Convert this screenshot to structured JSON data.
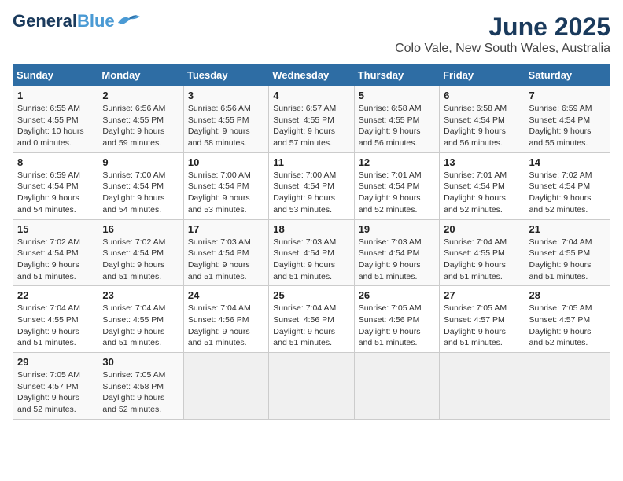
{
  "logo": {
    "text_general": "General",
    "text_blue": "Blue"
  },
  "title": "June 2025",
  "subtitle": "Colo Vale, New South Wales, Australia",
  "days_of_week": [
    "Sunday",
    "Monday",
    "Tuesday",
    "Wednesday",
    "Thursday",
    "Friday",
    "Saturday"
  ],
  "weeks": [
    [
      {
        "day": "1",
        "sunrise": "6:55 AM",
        "sunset": "4:55 PM",
        "daylight": "10 hours and 0 minutes."
      },
      {
        "day": "2",
        "sunrise": "6:56 AM",
        "sunset": "4:55 PM",
        "daylight": "9 hours and 59 minutes."
      },
      {
        "day": "3",
        "sunrise": "6:56 AM",
        "sunset": "4:55 PM",
        "daylight": "9 hours and 58 minutes."
      },
      {
        "day": "4",
        "sunrise": "6:57 AM",
        "sunset": "4:55 PM",
        "daylight": "9 hours and 57 minutes."
      },
      {
        "day": "5",
        "sunrise": "6:58 AM",
        "sunset": "4:55 PM",
        "daylight": "9 hours and 56 minutes."
      },
      {
        "day": "6",
        "sunrise": "6:58 AM",
        "sunset": "4:54 PM",
        "daylight": "9 hours and 56 minutes."
      },
      {
        "day": "7",
        "sunrise": "6:59 AM",
        "sunset": "4:54 PM",
        "daylight": "9 hours and 55 minutes."
      }
    ],
    [
      {
        "day": "8",
        "sunrise": "6:59 AM",
        "sunset": "4:54 PM",
        "daylight": "9 hours and 54 minutes."
      },
      {
        "day": "9",
        "sunrise": "7:00 AM",
        "sunset": "4:54 PM",
        "daylight": "9 hours and 54 minutes."
      },
      {
        "day": "10",
        "sunrise": "7:00 AM",
        "sunset": "4:54 PM",
        "daylight": "9 hours and 53 minutes."
      },
      {
        "day": "11",
        "sunrise": "7:00 AM",
        "sunset": "4:54 PM",
        "daylight": "9 hours and 53 minutes."
      },
      {
        "day": "12",
        "sunrise": "7:01 AM",
        "sunset": "4:54 PM",
        "daylight": "9 hours and 52 minutes."
      },
      {
        "day": "13",
        "sunrise": "7:01 AM",
        "sunset": "4:54 PM",
        "daylight": "9 hours and 52 minutes."
      },
      {
        "day": "14",
        "sunrise": "7:02 AM",
        "sunset": "4:54 PM",
        "daylight": "9 hours and 52 minutes."
      }
    ],
    [
      {
        "day": "15",
        "sunrise": "7:02 AM",
        "sunset": "4:54 PM",
        "daylight": "9 hours and 51 minutes."
      },
      {
        "day": "16",
        "sunrise": "7:02 AM",
        "sunset": "4:54 PM",
        "daylight": "9 hours and 51 minutes."
      },
      {
        "day": "17",
        "sunrise": "7:03 AM",
        "sunset": "4:54 PM",
        "daylight": "9 hours and 51 minutes."
      },
      {
        "day": "18",
        "sunrise": "7:03 AM",
        "sunset": "4:54 PM",
        "daylight": "9 hours and 51 minutes."
      },
      {
        "day": "19",
        "sunrise": "7:03 AM",
        "sunset": "4:54 PM",
        "daylight": "9 hours and 51 minutes."
      },
      {
        "day": "20",
        "sunrise": "7:04 AM",
        "sunset": "4:55 PM",
        "daylight": "9 hours and 51 minutes."
      },
      {
        "day": "21",
        "sunrise": "7:04 AM",
        "sunset": "4:55 PM",
        "daylight": "9 hours and 51 minutes."
      }
    ],
    [
      {
        "day": "22",
        "sunrise": "7:04 AM",
        "sunset": "4:55 PM",
        "daylight": "9 hours and 51 minutes."
      },
      {
        "day": "23",
        "sunrise": "7:04 AM",
        "sunset": "4:55 PM",
        "daylight": "9 hours and 51 minutes."
      },
      {
        "day": "24",
        "sunrise": "7:04 AM",
        "sunset": "4:56 PM",
        "daylight": "9 hours and 51 minutes."
      },
      {
        "day": "25",
        "sunrise": "7:04 AM",
        "sunset": "4:56 PM",
        "daylight": "9 hours and 51 minutes."
      },
      {
        "day": "26",
        "sunrise": "7:05 AM",
        "sunset": "4:56 PM",
        "daylight": "9 hours and 51 minutes."
      },
      {
        "day": "27",
        "sunrise": "7:05 AM",
        "sunset": "4:57 PM",
        "daylight": "9 hours and 51 minutes."
      },
      {
        "day": "28",
        "sunrise": "7:05 AM",
        "sunset": "4:57 PM",
        "daylight": "9 hours and 52 minutes."
      }
    ],
    [
      {
        "day": "29",
        "sunrise": "7:05 AM",
        "sunset": "4:57 PM",
        "daylight": "9 hours and 52 minutes."
      },
      {
        "day": "30",
        "sunrise": "7:05 AM",
        "sunset": "4:58 PM",
        "daylight": "9 hours and 52 minutes."
      },
      null,
      null,
      null,
      null,
      null
    ]
  ]
}
